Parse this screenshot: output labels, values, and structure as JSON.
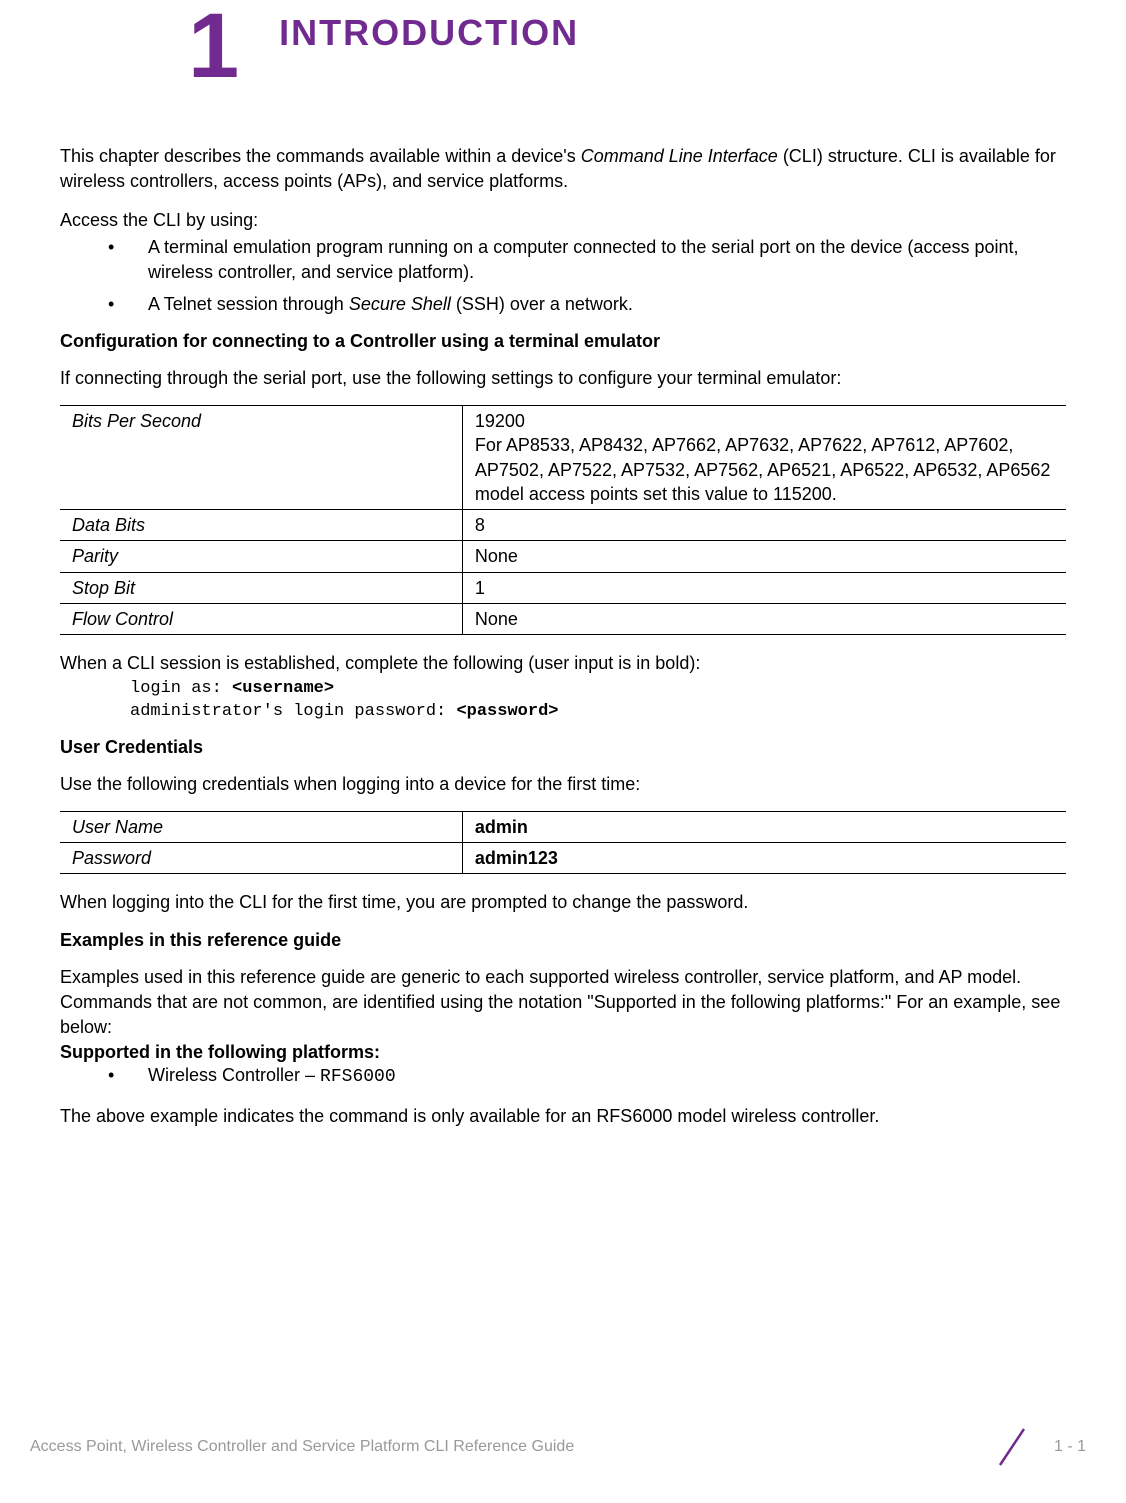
{
  "chapter": {
    "number": "1",
    "title": "INTRODUCTION"
  },
  "intro": {
    "p1a": "This chapter describes the commands available within a device's ",
    "p1b": "Command Line Interface",
    "p1c": " (CLI) structure. CLI is available for wireless controllers, access points (APs), and service platforms.",
    "p2": "Access the CLI by using:",
    "bullet1": "A terminal emulation program running on a computer connected to the serial port on the device (access point, wireless controller, and service platform).",
    "bullet2a": "A Telnet session through ",
    "bullet2b": "Secure Shell",
    "bullet2c": " (SSH) over a network."
  },
  "config": {
    "heading": "Configuration for connecting to a Controller using a terminal emulator",
    "para": "If connecting through the serial port, use the following settings to configure your terminal emulator:",
    "rows": [
      {
        "label": "Bits Per Second",
        "value": "19200\nFor AP8533, AP8432, AP7662, AP7632, AP7622, AP7612, AP7602, AP7502, AP7522, AP7532, AP7562, AP6521, AP6522, AP6532, AP6562 model access points set this value to 115200."
      },
      {
        "label": "Data Bits",
        "value": "8"
      },
      {
        "label": "Parity",
        "value": "None"
      },
      {
        "label": "Stop Bit",
        "value": "1"
      },
      {
        "label": "Flow Control",
        "value": "None"
      }
    ],
    "after": "When a CLI session is established, complete the following (user input is in bold):",
    "code": {
      "line1a": "login as: ",
      "line1b": "<username>",
      "line2a": "administrator's login password: ",
      "line2b": "<password>"
    }
  },
  "creds": {
    "heading": "User Credentials",
    "para": "Use the following credentials when logging into a device for the first time:",
    "rows": [
      {
        "label": "User Name",
        "value": "admin"
      },
      {
        "label": "Password",
        "value": "admin123"
      }
    ],
    "after": "When logging into the CLI for the first time, you are prompted to change the password."
  },
  "examples": {
    "heading": "Examples in this reference guide",
    "para": "Examples used in this reference guide are generic to each supported wireless controller, service platform, and AP model. Commands that are not common, are identified using the notation \"Supported in the following platforms:\" For an example, see below:",
    "subheading": "Supported in the following platforms:",
    "bullet1a": "Wireless Controller – ",
    "bullet1b": "RFS6000",
    "after1": "The above example indicates the command is only available for ",
    "after2": "an ",
    "after3": "RFS6000 model wireless controller."
  },
  "footer": {
    "left": "Access Point, Wireless Controller and Service Platform CLI Reference Guide",
    "page": "1 - 1"
  }
}
